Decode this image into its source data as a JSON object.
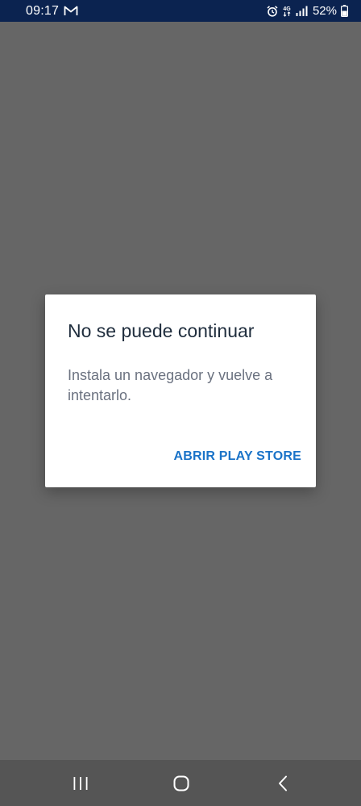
{
  "status_bar": {
    "time": "09:17",
    "battery": "52%",
    "icons": [
      "gmail-icon",
      "alarm-icon",
      "data-4g-icon",
      "signal-icon",
      "battery-icon"
    ]
  },
  "dialog": {
    "title": "No se puede continuar",
    "message": "Instala un navegador y vuelve a intentarlo.",
    "action_label": "ABRIR PLAY STORE"
  },
  "nav_bar": {
    "icons": [
      "recents-icon",
      "home-icon",
      "back-icon"
    ]
  },
  "colors": {
    "status_bar": "#0b2350",
    "backdrop": "#666666",
    "dialog": "#ffffff",
    "accent": "#1a73c8",
    "nav_bar": "#555555"
  }
}
